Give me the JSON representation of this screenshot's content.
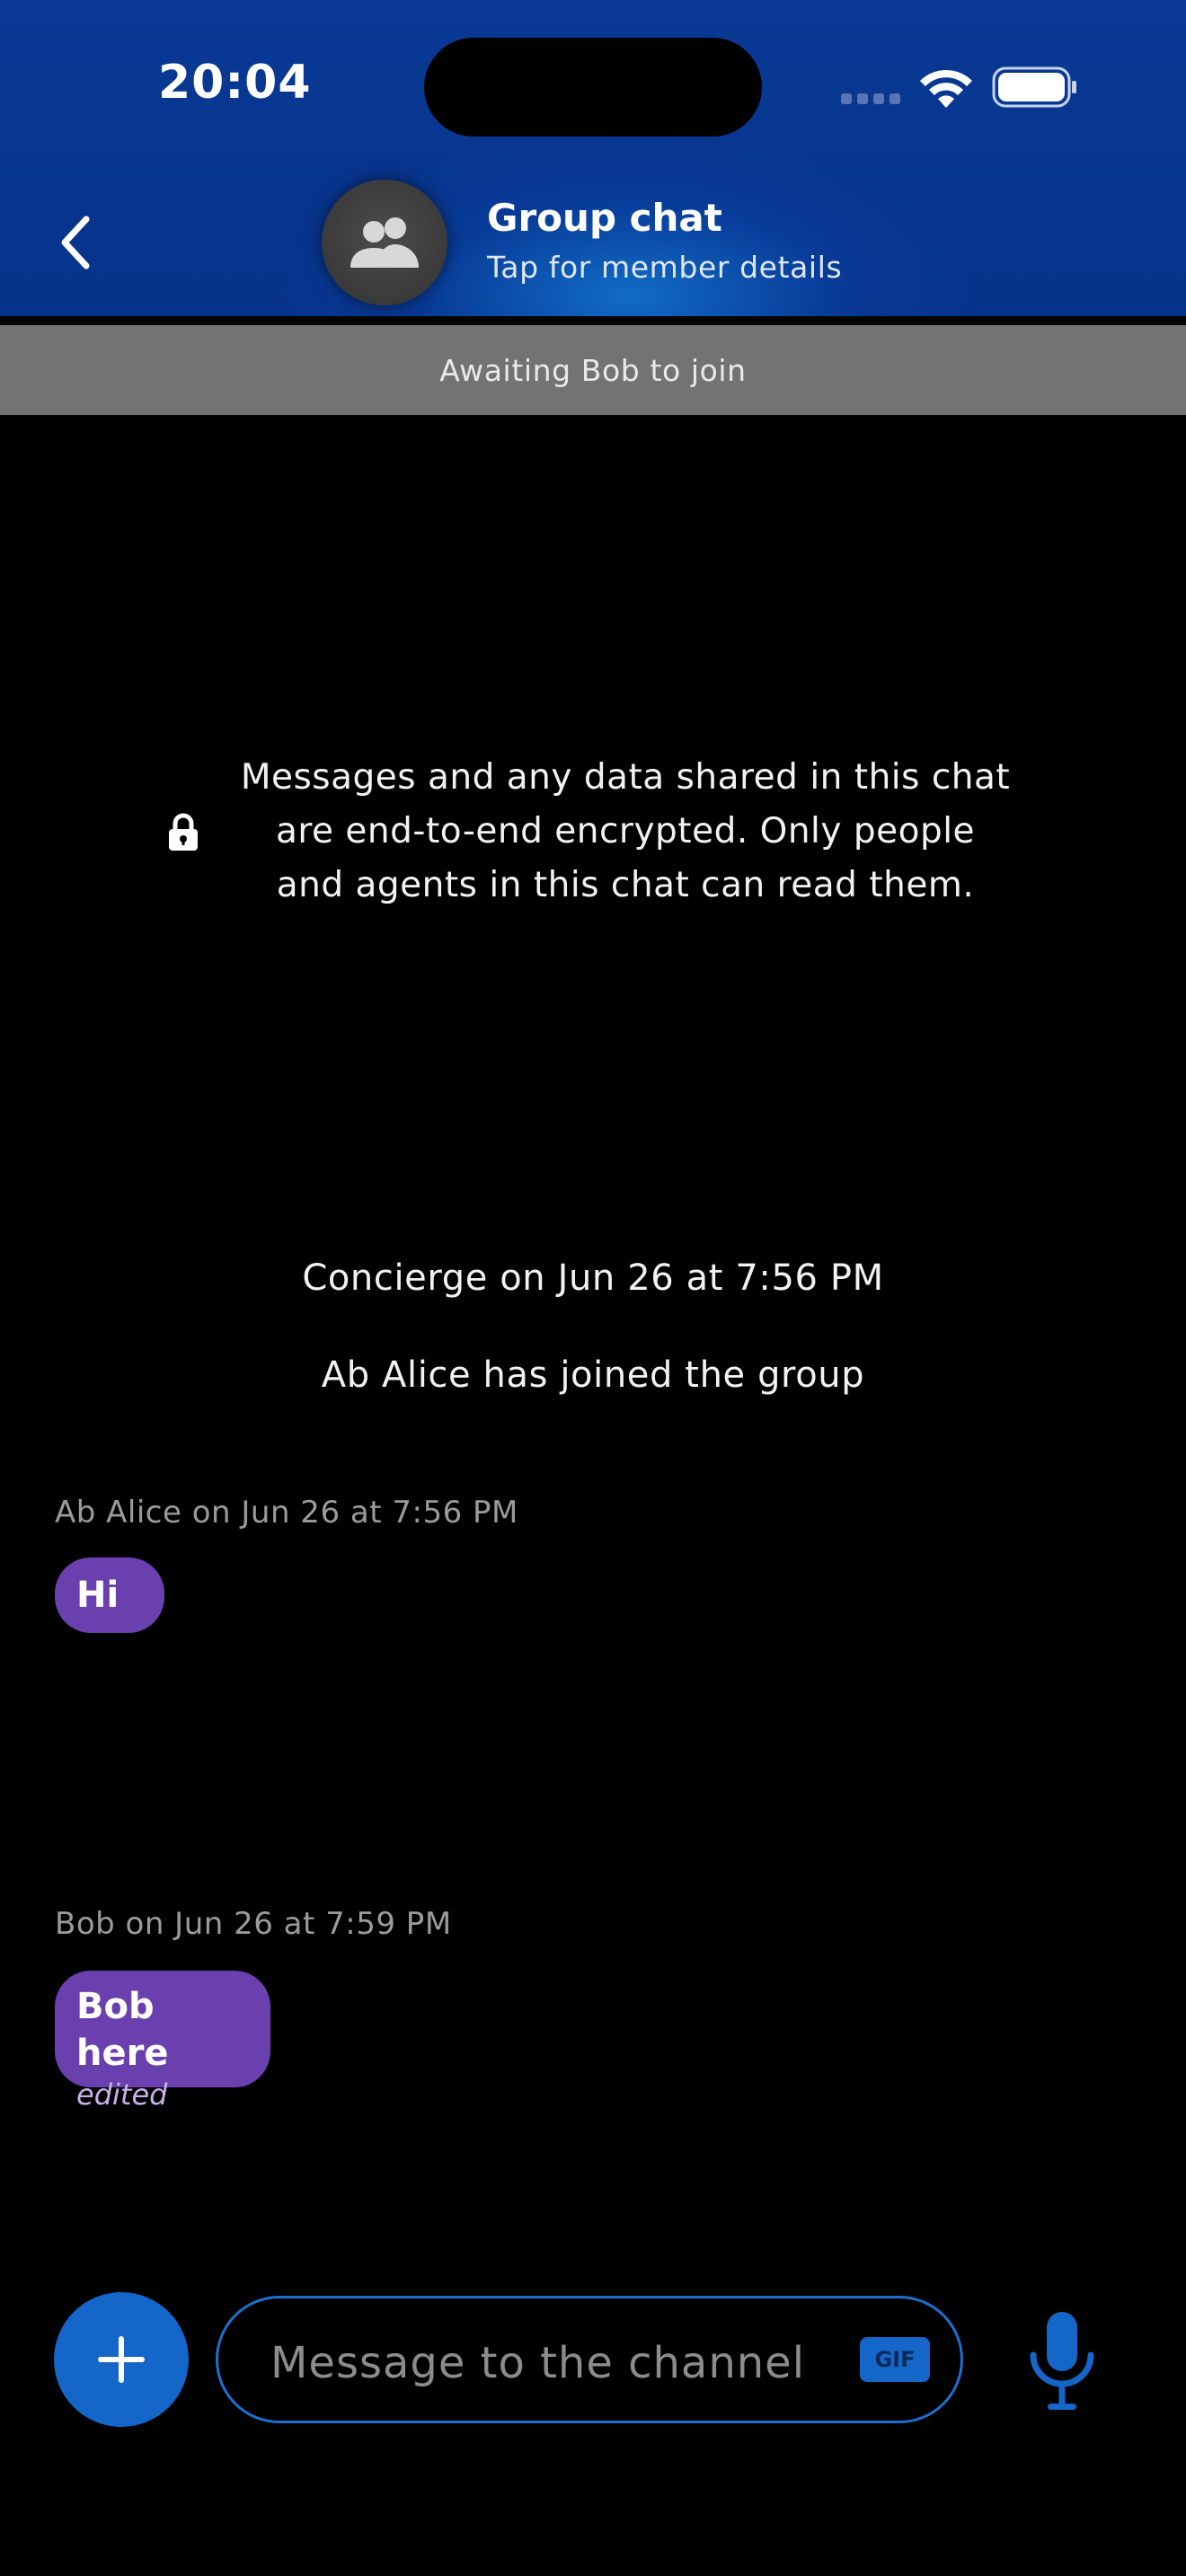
{
  "status_bar": {
    "time": "20:04"
  },
  "header": {
    "title": "Group chat",
    "subtitle": "Tap for member details",
    "back_icon": "chevron-left-icon",
    "avatar_icon": "group-people-icon"
  },
  "banner": {
    "text": "Awaiting Bob to join"
  },
  "encryption": {
    "icon": "lock-icon",
    "line1": "Messages and any data shared in this chat",
    "line2": "are end-to-end encrypted. Only people",
    "line3": "and agents in this chat can read them."
  },
  "system_messages": [
    {
      "text": "Concierge on Jun 26 at 7:56 PM"
    },
    {
      "text": "Ab Alice has joined the group"
    }
  ],
  "messages": [
    {
      "meta": "Ab Alice on Jun 26 at 7:56 PM",
      "text": "Hi"
    },
    {
      "meta": "Bob on Jun 26 at 7:59 PM",
      "text": "Bob here",
      "edited": "edited"
    }
  ],
  "composer": {
    "placeholder": "Message to the channel",
    "gif_label": "GIF",
    "add_icon": "plus-icon",
    "mic_icon": "microphone-icon"
  },
  "colors": {
    "header_bg": "#07358e",
    "accent": "#1466c8",
    "bubble": "#6a3fae",
    "banner_bg": "#737373"
  }
}
